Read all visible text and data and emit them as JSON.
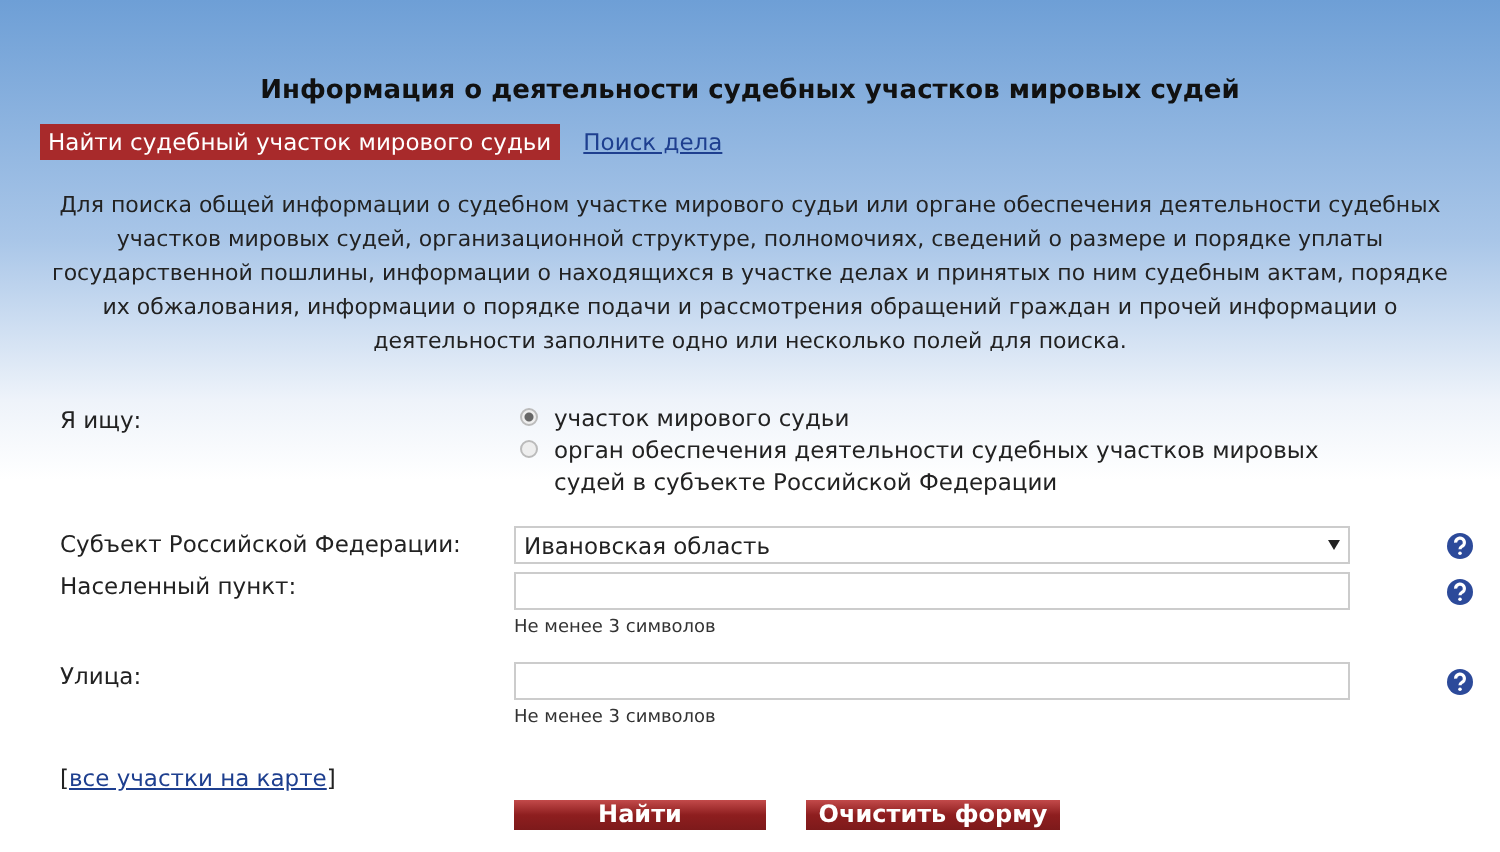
{
  "title": "Информация о деятельности судебных участков мировых судей",
  "tabs": [
    {
      "label": "Найти судебный участок мирового судьи",
      "selected": true
    },
    {
      "label": "Поиск дела",
      "selected": false
    }
  ],
  "description": "Для поиска общей информации о судебном участке мирового судьи или органе обеспечения деятельности судебных участков мировых судей, организационной структуре, полномочиях, сведений о размере и порядке уплаты государственной пошлины, информации о находящихся в участке делах и принятых по ним судебным актам, порядке их обжалования, информации о порядке подачи и рассмотрения обращений граждан и прочей информации о деятельности заполните одно или несколько полей для поиска.",
  "search_for": {
    "label": "Я ищу:",
    "options": [
      {
        "label": "участок мирового судьи",
        "selected": true
      },
      {
        "label": "орган обеспечения деятельности судебных участков мировых судей в субъекте Российской Федерации",
        "selected": false
      }
    ]
  },
  "fields": [
    {
      "kind": "select",
      "label": "Субъект Российской Федерации:",
      "value": "Ивановская область"
    },
    {
      "kind": "text",
      "label": "Населенный пункт:",
      "hint": "Не менее 3 символов"
    },
    {
      "kind": "text",
      "label": "Улица:",
      "hint": "Не менее 3 символов"
    }
  ],
  "map_link": {
    "open": "[",
    "label": "все участки на карте",
    "close": "]"
  },
  "buttons": [
    "Найти",
    "Очистить форму"
  ]
}
